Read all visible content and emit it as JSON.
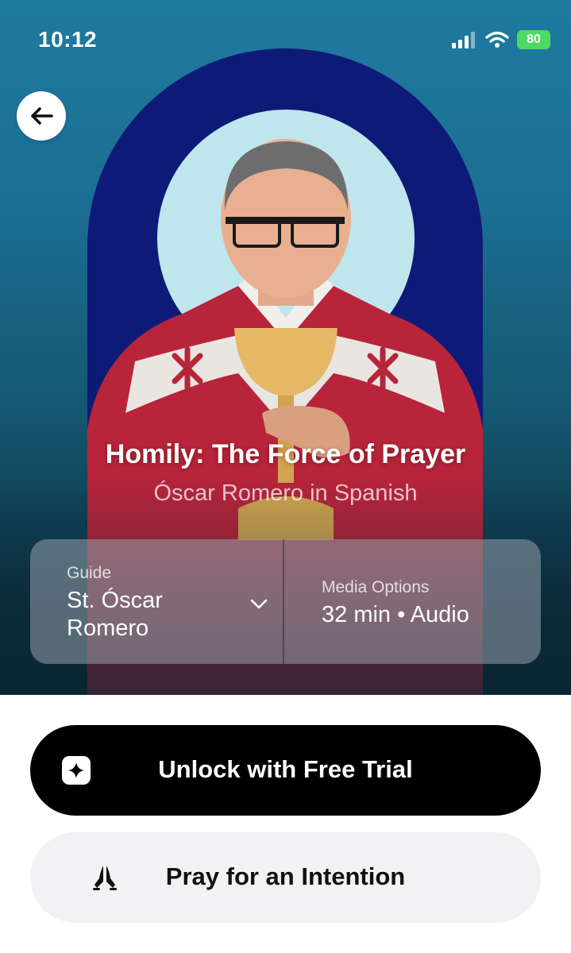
{
  "status_bar": {
    "time": "10:12",
    "battery": "80"
  },
  "header": {
    "title": "Homily: The Force of Prayer",
    "subtitle": "Óscar Romero in Spanish"
  },
  "info": {
    "guide_label": "Guide",
    "guide_value": "St. Óscar Romero",
    "media_label": "Media Options",
    "media_value": "32 min • Audio"
  },
  "actions": {
    "primary_label": "Unlock with Free Trial",
    "secondary_label": "Pray for an Intention"
  },
  "colors": {
    "hero_top": "#1f7aa0",
    "arch": "#0e1a78",
    "halo": "#bfe6ec",
    "vestment_red": "#b8243a",
    "primary_button": "#000000",
    "secondary_button": "#f2f1f4"
  },
  "icons": {
    "back": "arrow-left-icon",
    "guide_dropdown": "chevron-down-icon",
    "primary": "sparkle-icon",
    "secondary": "praying-hands-icon"
  }
}
